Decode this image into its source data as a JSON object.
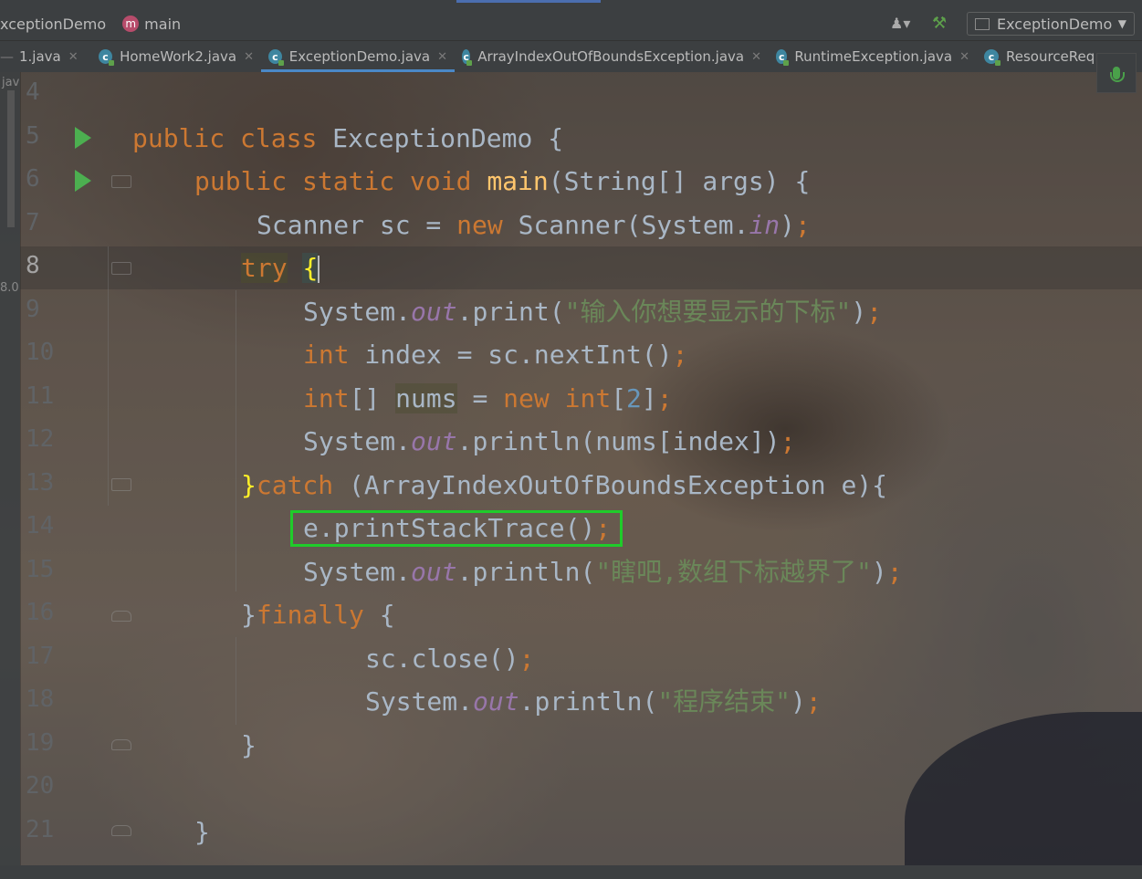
{
  "navbar": {
    "breadcrumb_class": "xceptionDemo",
    "breadcrumb_method_icon": "m",
    "breadcrumb_method": "main",
    "run_config": "ExceptionDemo"
  },
  "tabs": [
    {
      "label": "1.java",
      "active": false
    },
    {
      "label": "HomeWork2.java",
      "active": false
    },
    {
      "label": "ExceptionDemo.java",
      "active": true
    },
    {
      "label": "ArrayIndexOutOfBoundsException.java",
      "active": false
    },
    {
      "label": "RuntimeException.java",
      "active": false
    },
    {
      "label": "ResourceReq",
      "active": false
    }
  ],
  "left_panel": {
    "label_top": "jav",
    "label_mid": "8.0"
  },
  "line_numbers": [
    "4",
    "5",
    "6",
    "7",
    "8",
    "9",
    "10",
    "11",
    "12",
    "13",
    "14",
    "15",
    "16",
    "17",
    "18",
    "19",
    "20",
    "21"
  ],
  "current_line": "8",
  "code": {
    "l5": {
      "kw1": "public",
      "kw2": "class",
      "name": "ExceptionDemo",
      "brace": "{"
    },
    "l6": {
      "kw1": "public",
      "kw2": "static",
      "kw3": "void",
      "fn": "main",
      "params": "(String[] args) {"
    },
    "l7": {
      "a": "Scanner sc = ",
      "kw": "new",
      "b": " Scanner(System.",
      "fld": "in",
      "c": ")",
      "semi": ";"
    },
    "l8": {
      "kw": "try",
      "brace": "{"
    },
    "l9": {
      "a": "System.",
      "fld": "out",
      "b": ".print(",
      "str": "\"输入你想要显示的下标\"",
      "c": ")",
      "semi": ";"
    },
    "l10": {
      "kw": "int",
      "a": " index = sc.nextInt()",
      "semi": ";"
    },
    "l11": {
      "kw": "int",
      "a": "[] ",
      "var": "nums",
      "b": " = ",
      "kw2": "new",
      "c": " ",
      "kw3": "int",
      "d": "[",
      "num": "2",
      "e": "]",
      "semi": ";"
    },
    "l12": {
      "a": "System.",
      "fld": "out",
      "b": ".println(nums[index])",
      "semi": ";"
    },
    "l13": {
      "brace": "}",
      "kw": "catch",
      "a": " (ArrayIndexOutOfBoundsException e){"
    },
    "l14": {
      "a": "e.printStackTrace()",
      "semi": ";"
    },
    "l15": {
      "a": "System.",
      "fld": "out",
      "b": ".println(",
      "str": "\"瞎吧,数组下标越界了\"",
      "c": ")",
      "semi": ";"
    },
    "l16": {
      "brace": "}",
      "kw": "finally",
      "a": " {"
    },
    "l17": {
      "a": "sc.close()",
      "semi": ";"
    },
    "l18": {
      "a": "System.",
      "fld": "out",
      "b": ".println(",
      "str": "\"程序结束\"",
      "c": ")",
      "semi": ";"
    },
    "l19": {
      "a": "}"
    },
    "l21": {
      "a": "}"
    }
  },
  "colors": {
    "keyword": "#cc7832",
    "function": "#ffc66d",
    "string": "#6a8759",
    "number": "#6897bb",
    "field": "#9876aa",
    "highlight_box": "#1fcc2a"
  }
}
